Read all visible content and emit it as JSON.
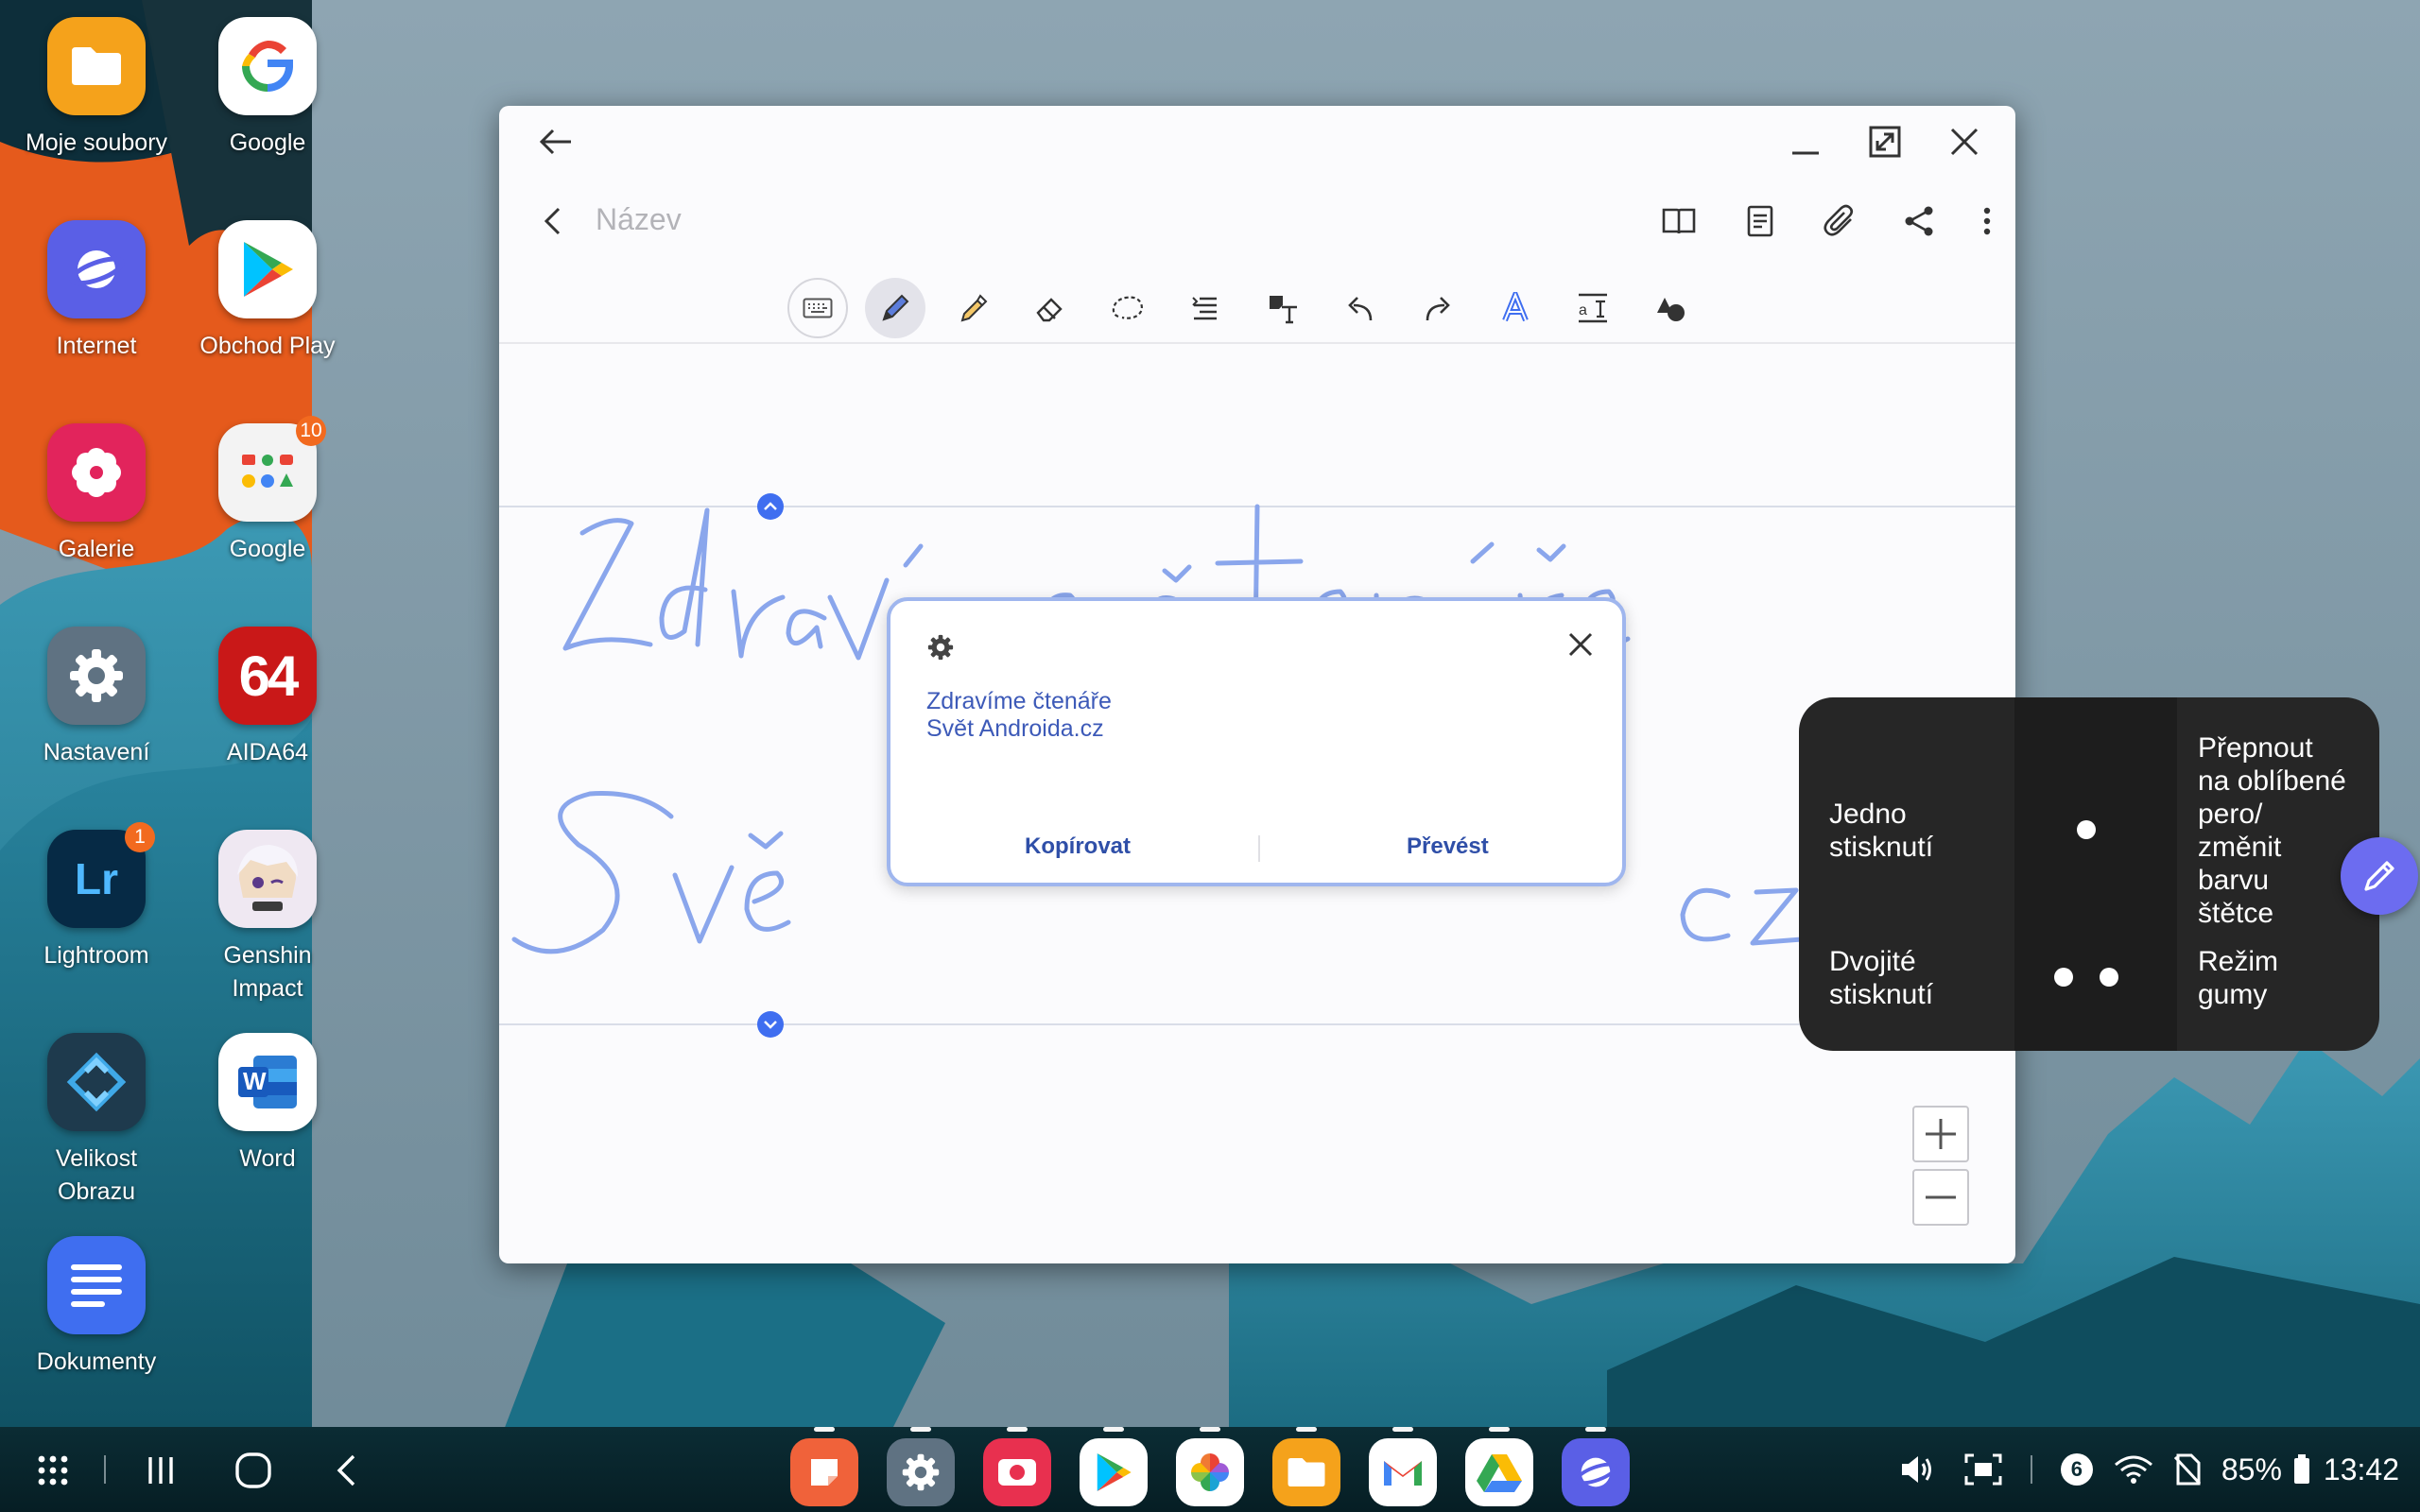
{
  "desktop": {
    "apps": [
      {
        "label": "Moje soubory",
        "icon": "folder-icon",
        "color": "#f5a21b"
      },
      {
        "label": "Google",
        "icon": "google-icon",
        "color": "#ffffff"
      },
      {
        "label": "Internet",
        "icon": "samsung-internet-icon",
        "color": "#5a5fe6"
      },
      {
        "label": "Obchod Play",
        "icon": "play-store-icon",
        "color": "#ffffff"
      },
      {
        "label": "Galerie",
        "icon": "gallery-flower-icon",
        "color": "#e2245c"
      },
      {
        "label": "Google",
        "icon": "google-folder-icon",
        "color": "#f3f3f3",
        "badge": "10"
      },
      {
        "label": "Nastavení",
        "icon": "settings-gear-icon",
        "color": "#5f7282"
      },
      {
        "label": "AIDA64",
        "icon": "aida64-icon",
        "color": "#c91818",
        "glyph": "64"
      },
      {
        "label": "Lightroom",
        "icon": "lightroom-icon",
        "color": "#062a45",
        "glyph": "Lr",
        "badge": "1"
      },
      {
        "label": "Genshin\nImpact",
        "icon": "genshin-impact-icon",
        "color": "#efe8f2"
      },
      {
        "label": "Velikost\nObrazu",
        "icon": "image-size-icon",
        "color": "#1e3a4d"
      },
      {
        "label": "Word",
        "icon": "word-icon",
        "color": "#ffffff",
        "glyph": "W"
      },
      {
        "label": "Dokumenty",
        "icon": "documents-icon",
        "color": "#3f6ef0"
      }
    ]
  },
  "note": {
    "title_placeholder": "Název",
    "popup": {
      "recognized_line1": "Zdravíme čtenáře",
      "recognized_line2": "Svět Androida.cz",
      "copy_label": "Kopírovat",
      "convert_label": "Převést"
    }
  },
  "pen_hint": {
    "single_label": "Jedno\nstisknutí",
    "single_action": "Přepnout\nna oblíbené\npero/\nzměnit\nbarvu\nštětce",
    "double_label": "Dvojité\nstisknutí",
    "double_action": "Režim\ngumy"
  },
  "taskbar": {
    "dock_apps": [
      {
        "icon": "samsung-notes-icon",
        "color": "#f0623a"
      },
      {
        "icon": "settings-gear-icon",
        "color": "#5f7282"
      },
      {
        "icon": "screen-recorder-icon",
        "color": "#e8304f"
      },
      {
        "icon": "play-store-icon",
        "color": "#ffffff"
      },
      {
        "icon": "google-photos-icon",
        "color": "#ffffff"
      },
      {
        "icon": "folder-icon",
        "color": "#f5a21b"
      },
      {
        "icon": "gmail-icon",
        "color": "#ffffff"
      },
      {
        "icon": "google-drive-icon",
        "color": "#ffffff"
      },
      {
        "icon": "samsung-internet-icon",
        "color": "#5a5fe6"
      }
    ],
    "status": {
      "notification_count": "6",
      "battery": "85%",
      "time": "13:42"
    }
  },
  "colors": {
    "ink": "#8aa6ec",
    "accent": "#3f6ef0",
    "fab": "#6c6cf0"
  }
}
